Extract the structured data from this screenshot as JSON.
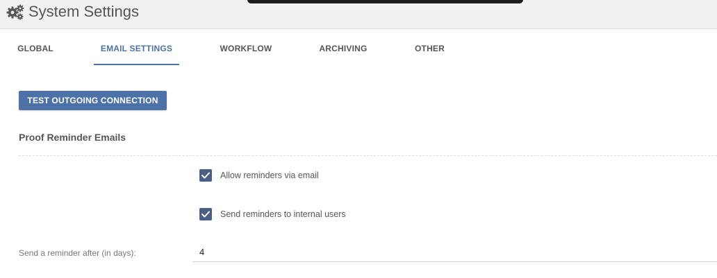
{
  "header": {
    "title": "System Settings",
    "icon": "gears-icon"
  },
  "tabs": [
    {
      "label": "GLOBAL",
      "active": false
    },
    {
      "label": "EMAIL SETTINGS",
      "active": true
    },
    {
      "label": "WORKFLOW",
      "active": false
    },
    {
      "label": "ARCHIVING",
      "active": false
    },
    {
      "label": "OTHER",
      "active": false
    }
  ],
  "email": {
    "test_button_label": "TEST OUTGOING CONNECTION",
    "section_title": "Proof Reminder Emails",
    "checkboxes": [
      {
        "label": "Allow reminders via email",
        "checked": true
      },
      {
        "label": "Send reminders to internal users",
        "checked": true
      }
    ],
    "reminder_field": {
      "label": "Send a reminder after (in days):",
      "value": "4"
    }
  },
  "colors": {
    "accent": "#4d72a8",
    "checkbox": "#4a5f86",
    "header_bg": "#f1f1f2"
  }
}
